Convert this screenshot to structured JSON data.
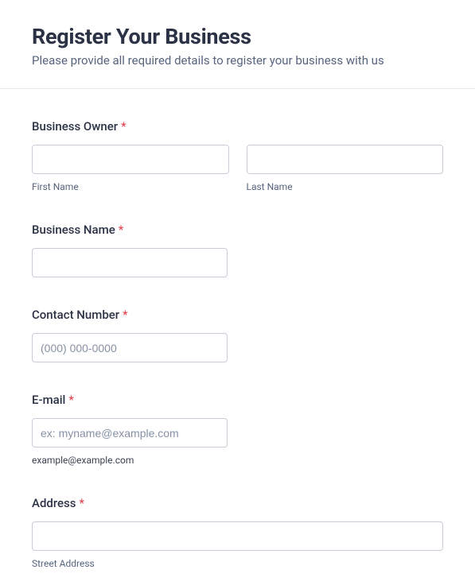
{
  "header": {
    "title": "Register Your Business",
    "subtitle": "Please provide all required details to register your business with us"
  },
  "required_mark": "*",
  "owner": {
    "label": "Business Owner",
    "first_sublabel": "First Name",
    "last_sublabel": "Last Name"
  },
  "business_name": {
    "label": "Business Name"
  },
  "contact": {
    "label": "Contact Number",
    "placeholder": "(000) 000-0000"
  },
  "email": {
    "label": "E-mail",
    "placeholder": "ex: myname@example.com",
    "hint": "example@example.com"
  },
  "address": {
    "label": "Address",
    "street_sublabel": "Street Address"
  }
}
